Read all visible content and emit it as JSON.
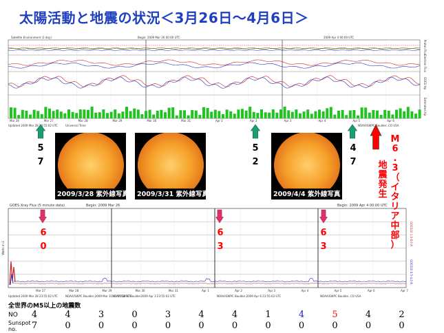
{
  "title": "太陽活動と地震の状況＜3月26日～4月6日＞",
  "top_chart": {
    "header_left": "Satellite Environment (3 day)",
    "header_begin": "Begin: 2009 Mar 26 00:00 UTC",
    "header_end": "2009 Apr 4 00:00 UTC",
    "right_labels": [
      "Proton Flux",
      "Electron Flux",
      "GOES Hp",
      "Estimated Kp"
    ],
    "x_ticks": [
      "Mar 26",
      "Mar 27",
      "Mar 28",
      "Mar 29",
      "Mar 30",
      "Mar 31",
      "Apr 1",
      "Apr 2",
      "Apr 3",
      "Apr 4",
      "Apr 5",
      "Apr 6"
    ],
    "footer": [
      "Updated 2009 Mar 28 23:55:02 UTC",
      "Universal Time",
      "NOAA/SWPC Boulder, CO USA"
    ]
  },
  "images": [
    {
      "caption": "2009/3/28  紫外線写真"
    },
    {
      "caption": "2009/3/31  紫外線写真"
    },
    {
      "caption": "2009/4/4  紫外線写真"
    }
  ],
  "markers": [
    {
      "color": "#1a9e73",
      "num_lines": [
        "5",
        "7"
      ],
      "num_color": "#ff0000"
    },
    {
      "color": "#1a9e73",
      "num_lines": [
        "5",
        "2"
      ],
      "num_color": "#ff0000"
    },
    {
      "color": "#1a9e73",
      "num_lines": [
        "4",
        "7"
      ],
      "num_color": "#2020c0"
    }
  ],
  "event_arrow": {
    "color": "#ff0000",
    "text_col1": "M6.3（イタリア中部）",
    "text_col2": "地震発生"
  },
  "xray_chart": {
    "header": "GOES Xray Flux (5 minute data)",
    "header_begin": "Begin: 2009 Mar 26",
    "header_end": "Begin: 2009 Apr 4 00:00 UTC",
    "y_label": "Watts m-2",
    "right_labels": [
      "GOES10 1.0-8.0 A",
      "GOES10 0.5-4.0 A"
    ],
    "x_ticks": [
      "Mar 27",
      "Mar 28",
      "Mar 29",
      "Mar 30",
      "Mar 31",
      "Apr 1",
      "Apr 2",
      "Apr 3",
      "Apr 4",
      "Apr 5",
      "Apr 6",
      "Apr 7"
    ],
    "footer": [
      "Updated 2009 Mar 28 23:55:02 UTC",
      "NOAA/SWPC Boulder,2009 Mar 31 23:55:02 UTC",
      "NOAA/SWPC Boulder2009 Apr 3 23:55:02 UTC",
      "NOAA/SWPC Boulder,2009 Apr 6 23:55:02 UTC",
      "NOAA/SWPC Boulder, CO USA"
    ]
  },
  "pink_markers": [
    {
      "color": "#e0306a",
      "num_lines": [
        "6",
        "0"
      ]
    },
    {
      "color": "#e0306a",
      "num_lines": [
        "6",
        "3"
      ]
    },
    {
      "color": "#e0306a",
      "num_lines": [
        "6",
        "3"
      ]
    }
  ],
  "chart_data": {
    "type": "table",
    "title": "全世界のM5以上の地震数",
    "row_labels": [
      "NO",
      "Sunspot no."
    ],
    "no_values": [
      4,
      4,
      3,
      0,
      3,
      4,
      4,
      1,
      4,
      5,
      4,
      2
    ],
    "no_colors": [
      "#000000",
      "#000000",
      "#000000",
      "#000000",
      "#000000",
      "#000000",
      "#000000",
      "#000000",
      "#2020c0",
      "#ff0000",
      "#000000",
      "#000000"
    ],
    "sunspot_values": [
      7,
      0,
      0,
      0,
      0,
      0,
      0,
      0,
      0,
      0,
      0,
      0
    ]
  }
}
